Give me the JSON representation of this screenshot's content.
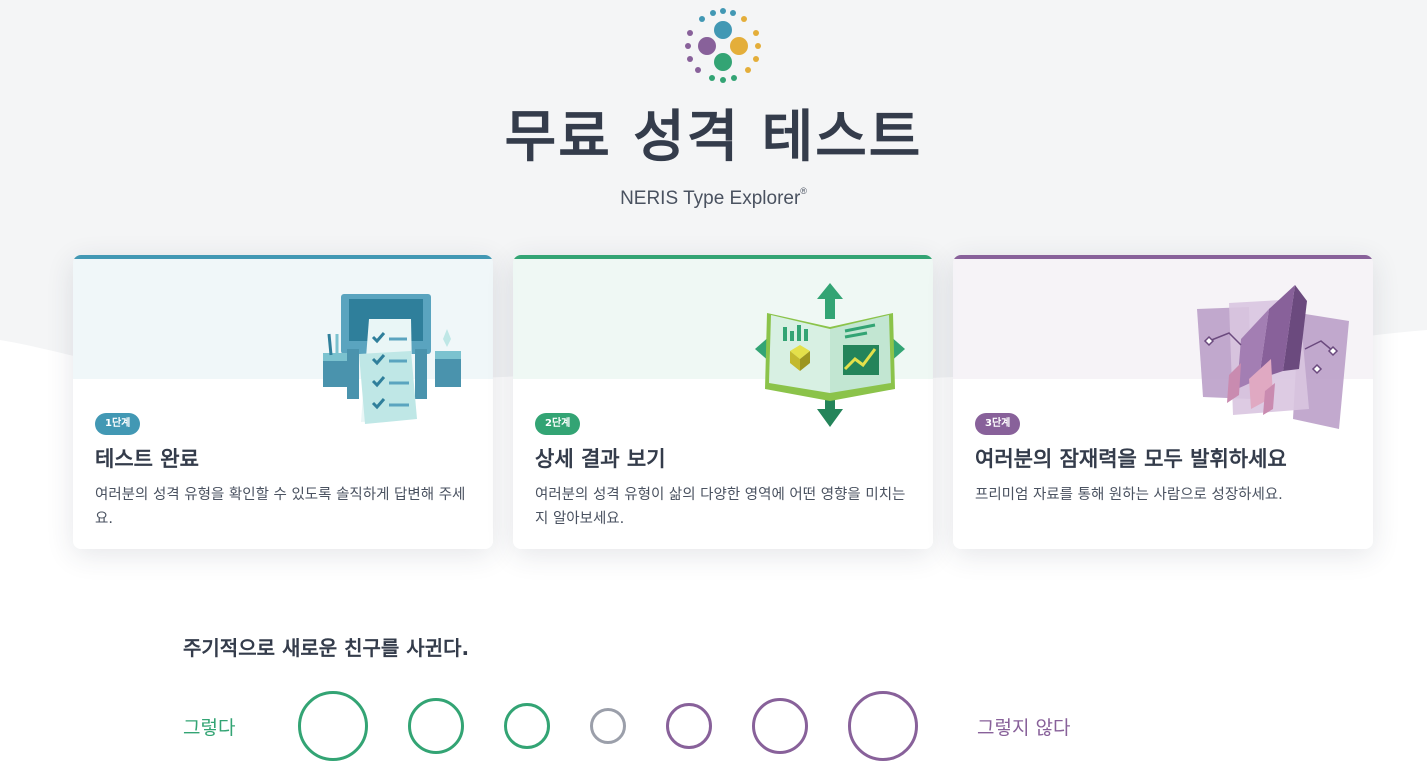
{
  "header": {
    "title": "무료 성격 테스트",
    "subtitle": "NERIS Type Explorer",
    "subtitle_mark": "®"
  },
  "steps": [
    {
      "badge": "1단계",
      "title": "테스트 완료",
      "description": "여러분의 성격 유형을 확인할 수 있도록 솔직하게 답변해 주세요.",
      "color": "#4298b4",
      "icon": "checklist-icon"
    },
    {
      "badge": "2단계",
      "title": "상세 결과 보기",
      "description": "여러분의 성격 유형이 삶의 다양한 영역에 어떤 영향을 미치는지 알아보세요.",
      "color": "#33a474",
      "icon": "book-growth-icon"
    },
    {
      "badge": "3단계",
      "title": "여러분의 잠재력을 모두 발휘하세요",
      "description": "프리미엄 자료를 통해 원하는 사람으로 성장하세요.",
      "color": "#88619a",
      "icon": "crystal-icon"
    }
  ],
  "question": {
    "text": "주기적으로 새로운 친구를 사귄다.",
    "agree_label": "그렇다",
    "disagree_label": "그렇지 않다",
    "agree_color": "#33a474",
    "neutral_color": "#9b9faa",
    "disagree_color": "#88619a"
  }
}
